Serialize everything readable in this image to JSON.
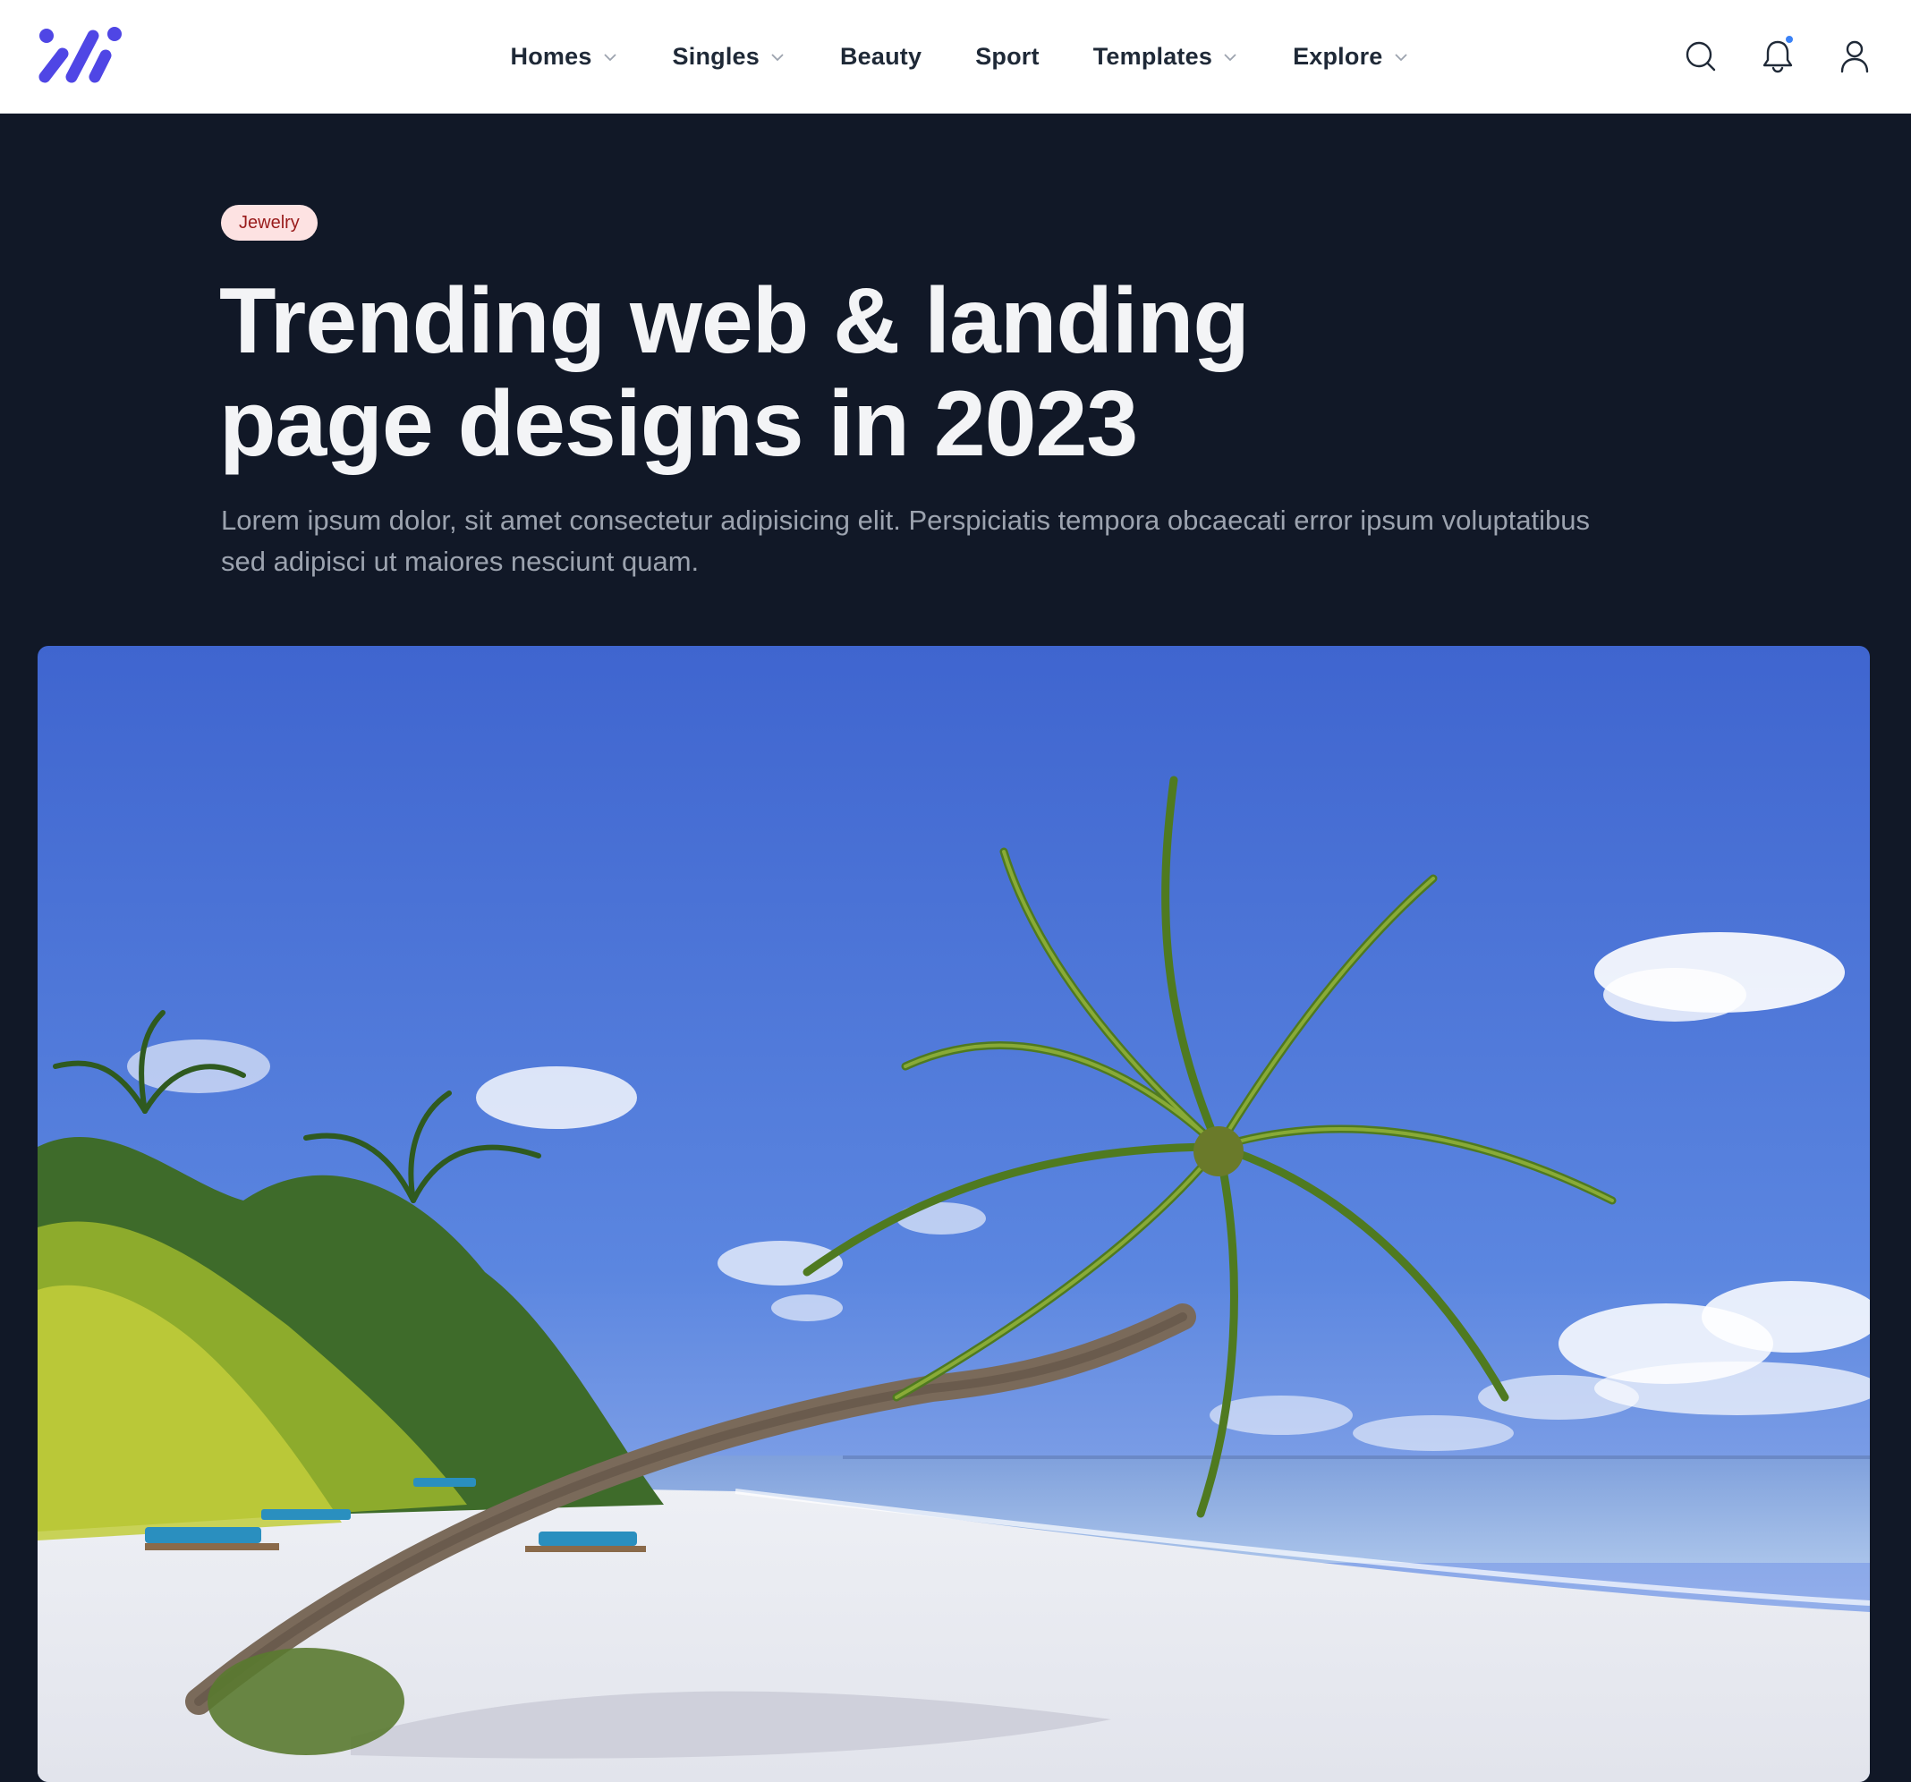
{
  "header": {
    "logo_icon": "brand-logo-icon",
    "nav": [
      {
        "label": "Homes",
        "dropdown": true
      },
      {
        "label": "Singles",
        "dropdown": true
      },
      {
        "label": "Beauty",
        "dropdown": false
      },
      {
        "label": "Sport",
        "dropdown": false
      },
      {
        "label": "Templates",
        "dropdown": true
      },
      {
        "label": "Explore",
        "dropdown": true
      }
    ],
    "icons": [
      "search-icon",
      "bell-icon",
      "user-icon"
    ],
    "accent_color": "#4f46e5",
    "notification_dot_color": "#3b82f6"
  },
  "hero": {
    "category_badge": "Jewelry",
    "title_line1": "Trending web & landing",
    "title_line2": "page designs in 2023",
    "subtitle_line1": "Lorem ipsum dolor, sit amet consectetur adipisicing elit. Perspiciatis tempora obcaecati error ipsum voluptatibus",
    "subtitle_line2": "sed adipisci ut maiores nesciunt quam.",
    "background_color": "#111827",
    "image": "tropical-beach-palm-tree-photo"
  }
}
